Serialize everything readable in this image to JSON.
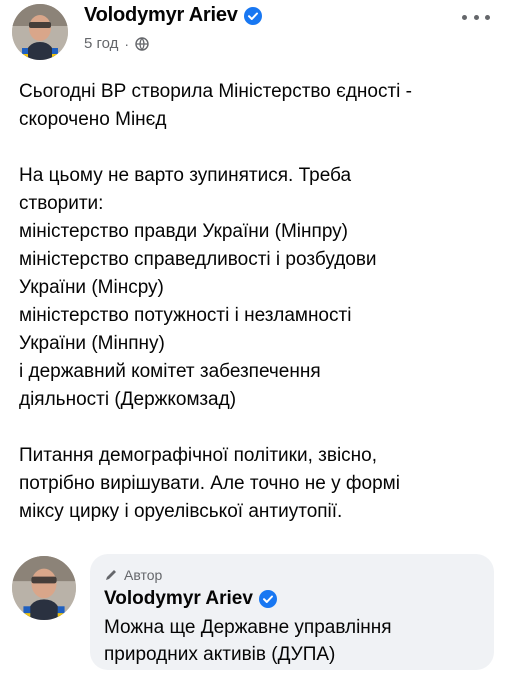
{
  "post": {
    "author": "Volodymyr Ariev",
    "time": "5 год",
    "separator": "·",
    "paragraphs": [
      [
        "Сьогодні ВР створила Міністерство єдності -",
        "скорочено Мінєд"
      ],
      [
        "На цьому не варто зупинятися. Треба",
        "створити:",
        "міністерство правди України (Мінпру)",
        "міністерство справедливості і розбудови",
        "України (Мінсру)",
        "міністерство потужності і незламності",
        "України (Мінпну)",
        "і державний комітет забезпечення",
        "діяльності (Держкомзад)"
      ],
      [
        "Питання демографічної політики, звісно,",
        "потрібно вирішувати. Але точно не у формі",
        "міксу цирку і оруелівської антиутопії."
      ]
    ]
  },
  "comment": {
    "badge": "Автор",
    "author": "Volodymyr Ariev",
    "lines": [
      "Можна ще Державне управління",
      "природних активів (ДУПА)"
    ]
  },
  "icons": {
    "verified": "verified-badge-icon",
    "globe": "globe-icon",
    "more": "more-options-icon",
    "pencil": "pencil-icon"
  },
  "colors": {
    "verified": "#1877f2",
    "meta": "#65676b",
    "bubble": "#f0f2f5",
    "text": "#050505"
  }
}
